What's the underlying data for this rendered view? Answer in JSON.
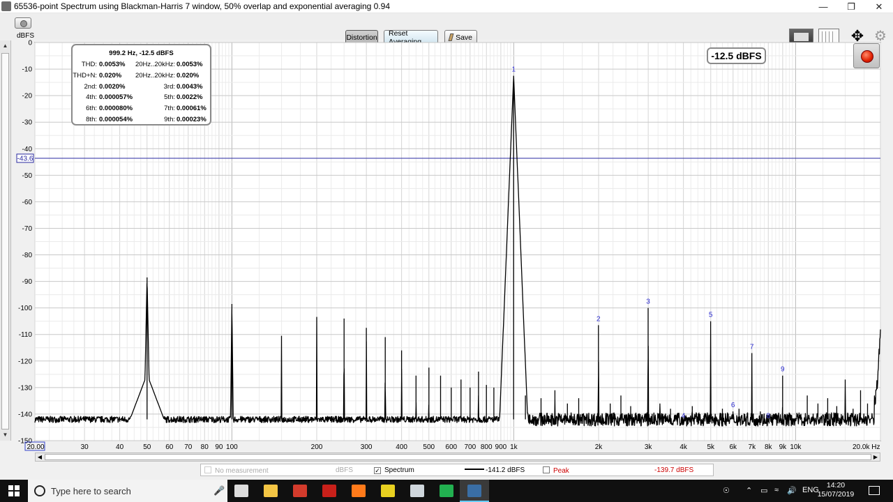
{
  "window": {
    "title": "65536-point Spectrum using Blackman-Harris 7 window, 50% overlap and exponential averaging 0.94",
    "controls": [
      "minimize",
      "restore",
      "close"
    ]
  },
  "toolbar": {
    "unit": "dBFS",
    "distortion_label": "Distortion",
    "reset_label": "Reset Averaging",
    "save_label": "Save"
  },
  "distortion": {
    "header": "999.2 Hz, -12.5 dBFS",
    "rows": [
      {
        "l1": "THD:",
        "v1": "0.0053%",
        "l2": "20Hz..20kHz:",
        "v2": "0.0053%"
      },
      {
        "l1": "THD+N:",
        "v1": "0.020%",
        "l2": "20Hz..20kHz:",
        "v2": "0.020%"
      },
      {
        "l1": "2nd:",
        "v1": "0.0020%",
        "l2": "3rd:",
        "v2": "0.0043%"
      },
      {
        "l1": "4th:",
        "v1": "0.000057%",
        "l2": "5th:",
        "v2": "0.0022%"
      },
      {
        "l1": "6th:",
        "v1": "0.000080%",
        "l2": "7th:",
        "v2": "0.00061%"
      },
      {
        "l1": "8th:",
        "v1": "0.000054%",
        "l2": "9th:",
        "v2": "0.00023%"
      }
    ]
  },
  "level_display": "-12.5 dBFS",
  "cursor_label": "-43.6",
  "legend": {
    "no_measurement": "No measurement",
    "no_measurement_unit": "dBFS",
    "spectrum_label": "Spectrum",
    "spectrum_value": "-141.2 dBFS",
    "peak_label": "Peak",
    "peak_value": "-139.7 dBFS",
    "peak_color": "#cc0000"
  },
  "chart_data": {
    "type": "line",
    "title": "",
    "xlabel": "Hz",
    "ylabel": "dBFS",
    "x_scale": "log",
    "xlim": [
      20,
      20000
    ],
    "ylim": [
      -150,
      0
    ],
    "grid": true,
    "cursor_y": -43.6,
    "x_ticks": [
      {
        "v": 20,
        "label": "20.00"
      },
      {
        "v": 30,
        "label": "30"
      },
      {
        "v": 40,
        "label": "40"
      },
      {
        "v": 50,
        "label": "50"
      },
      {
        "v": 60,
        "label": "60"
      },
      {
        "v": 70,
        "label": "70"
      },
      {
        "v": 80,
        "label": "80"
      },
      {
        "v": 90,
        "label": "90"
      },
      {
        "v": 100,
        "label": "100"
      },
      {
        "v": 200,
        "label": "200"
      },
      {
        "v": 300,
        "label": "300"
      },
      {
        "v": 400,
        "label": "400"
      },
      {
        "v": 500,
        "label": "500"
      },
      {
        "v": 600,
        "label": "600"
      },
      {
        "v": 700,
        "label": "700"
      },
      {
        "v": 800,
        "label": "800"
      },
      {
        "v": 900,
        "label": "900"
      },
      {
        "v": 1000,
        "label": "1k"
      },
      {
        "v": 2000,
        "label": "2k"
      },
      {
        "v": 3000,
        "label": "3k"
      },
      {
        "v": 4000,
        "label": "4k"
      },
      {
        "v": 5000,
        "label": "5k"
      },
      {
        "v": 6000,
        "label": "6k"
      },
      {
        "v": 7000,
        "label": "7k"
      },
      {
        "v": 8000,
        "label": "8k"
      },
      {
        "v": 9000,
        "label": "9k"
      },
      {
        "v": 10000,
        "label": "10k"
      },
      {
        "v": 20000,
        "label": "20.0k Hz"
      }
    ],
    "y_ticks": [
      0,
      -10,
      -20,
      -30,
      -40,
      -50,
      -60,
      -70,
      -80,
      -90,
      -100,
      -110,
      -120,
      -130,
      -140,
      -150
    ],
    "noise_floor": -142,
    "hum_peaks": [
      {
        "f": 50,
        "db": -88.5
      },
      {
        "f": 100,
        "db": -98.5
      },
      {
        "f": 150,
        "db": -110.5
      },
      {
        "f": 200,
        "db": -103.5
      },
      {
        "f": 250,
        "db": -104
      },
      {
        "f": 300,
        "db": -107.5
      },
      {
        "f": 350,
        "db": -111
      },
      {
        "f": 400,
        "db": -116
      },
      {
        "f": 450,
        "db": -125.5
      },
      {
        "f": 500,
        "db": -122.5
      },
      {
        "f": 550,
        "db": -125.5
      },
      {
        "f": 600,
        "db": -130
      },
      {
        "f": 650,
        "db": -127
      },
      {
        "f": 700,
        "db": -130
      },
      {
        "f": 750,
        "db": -124
      },
      {
        "f": 800,
        "db": -129
      },
      {
        "f": 850,
        "db": -130
      }
    ],
    "harmonics": [
      {
        "n": "1",
        "f": 999.2,
        "db": -12.5
      },
      {
        "n": "2",
        "f": 1998,
        "db": -106.5
      },
      {
        "n": "3",
        "f": 2998,
        "db": -100
      },
      {
        "n": "4",
        "f": 3997,
        "db": -143
      },
      {
        "n": "5",
        "f": 4996,
        "db": -105
      },
      {
        "n": "6",
        "f": 5995,
        "db": -139
      },
      {
        "n": "7",
        "f": 6994,
        "db": -117
      },
      {
        "n": "8",
        "f": 7994,
        "db": -143
      },
      {
        "n": "9",
        "f": 8993,
        "db": -125.5
      }
    ],
    "spurs": [
      {
        "f": 1100,
        "db": -133
      },
      {
        "f": 1250,
        "db": -134
      },
      {
        "f": 1400,
        "db": -131
      },
      {
        "f": 1550,
        "db": -136
      },
      {
        "f": 1700,
        "db": -134
      },
      {
        "f": 2200,
        "db": -136
      },
      {
        "f": 2400,
        "db": -133
      },
      {
        "f": 2600,
        "db": -137
      },
      {
        "f": 3300,
        "db": -136
      },
      {
        "f": 3600,
        "db": -138
      },
      {
        "f": 4300,
        "db": -137
      },
      {
        "f": 5500,
        "db": -138
      },
      {
        "f": 6300,
        "db": -138
      },
      {
        "f": 7500,
        "db": -139
      },
      {
        "f": 11000,
        "db": -133
      },
      {
        "f": 12000,
        "db": -136
      },
      {
        "f": 13000,
        "db": -134
      },
      {
        "f": 14000,
        "db": -137
      },
      {
        "f": 15000,
        "db": -127
      },
      {
        "f": 16000,
        "db": -138
      },
      {
        "f": 17000,
        "db": -131
      },
      {
        "f": 18000,
        "db": -136
      }
    ],
    "hf_rise": [
      {
        "f": 19000,
        "db": -135
      },
      {
        "f": 20000,
        "db": -106
      }
    ]
  },
  "taskbar": {
    "search_placeholder": "Type here to search",
    "apps": [
      {
        "name": "task-view",
        "color": "#dddddd"
      },
      {
        "name": "file-explorer",
        "color": "#f3c544"
      },
      {
        "name": "mail",
        "color": "#d33b2c"
      },
      {
        "name": "red-app",
        "color": "#c8201a"
      },
      {
        "name": "firefox",
        "color": "#ff7a1a"
      },
      {
        "name": "pdf",
        "color": "#e8d020"
      },
      {
        "name": "files",
        "color": "#cfd6dc"
      },
      {
        "name": "whatsapp",
        "color": "#22b050"
      },
      {
        "name": "rew",
        "color": "#3a6ea5"
      }
    ],
    "language": "ENG",
    "time": "14:20",
    "date": "15/07/2019"
  }
}
